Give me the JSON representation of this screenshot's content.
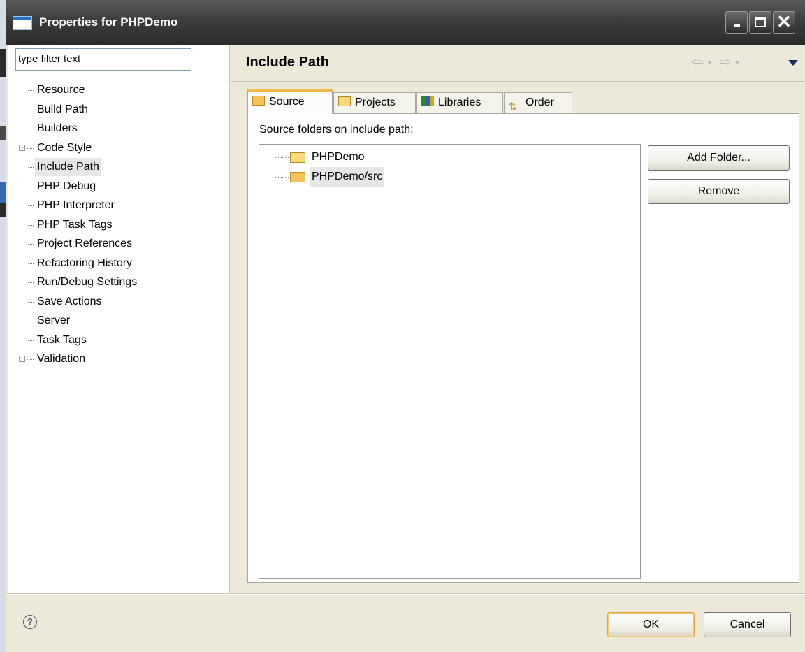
{
  "window": {
    "title": "Properties for PHPDemo"
  },
  "sidebar": {
    "filter_text": "type filter text",
    "items": [
      {
        "label": "Resource",
        "expandable": false,
        "selected": false
      },
      {
        "label": "Build Path",
        "expandable": false,
        "selected": false
      },
      {
        "label": "Builders",
        "expandable": false,
        "selected": false
      },
      {
        "label": "Code Style",
        "expandable": true,
        "selected": false
      },
      {
        "label": "Include Path",
        "expandable": false,
        "selected": true
      },
      {
        "label": "PHP Debug",
        "expandable": false,
        "selected": false
      },
      {
        "label": "PHP Interpreter",
        "expandable": false,
        "selected": false
      },
      {
        "label": "PHP Task Tags",
        "expandable": false,
        "selected": false
      },
      {
        "label": "Project References",
        "expandable": false,
        "selected": false
      },
      {
        "label": "Refactoring History",
        "expandable": false,
        "selected": false
      },
      {
        "label": "Run/Debug Settings",
        "expandable": false,
        "selected": false
      },
      {
        "label": "Save Actions",
        "expandable": false,
        "selected": false
      },
      {
        "label": "Server",
        "expandable": false,
        "selected": false
      },
      {
        "label": "Task Tags",
        "expandable": false,
        "selected": false
      },
      {
        "label": "Validation",
        "expandable": true,
        "selected": false
      }
    ],
    "expander_symbol": "+"
  },
  "main": {
    "title": "Include Path",
    "nav": {
      "back_icon": "arrow-left-icon",
      "forward_icon": "arrow-right-icon",
      "menu_icon": "view-menu-icon"
    },
    "tabs": [
      {
        "label": "Source",
        "icon": "source-folder-icon",
        "active": true
      },
      {
        "label": "Projects",
        "icon": "project-folder-icon",
        "active": false
      },
      {
        "label": "Libraries",
        "icon": "libraries-icon",
        "active": false
      },
      {
        "label": "Order",
        "icon": "order-icon",
        "active": false
      }
    ],
    "panel_label": "Source folders on include path:",
    "source_items": [
      {
        "label": "PHPDemo",
        "icon": "project-folder-icon",
        "selected": false
      },
      {
        "label": "PHPDemo/src",
        "icon": "source-folder-icon",
        "selected": true
      }
    ],
    "add_folder_label": "Add Folder...",
    "remove_label": "Remove"
  },
  "footer": {
    "help_symbol": "?",
    "ok_label": "OK",
    "cancel_label": "Cancel"
  },
  "colors": {
    "title_bar": "#3d3d3d",
    "dialog_bg": "#ece9d8",
    "active_tab_accent": "#f7b84a",
    "default_button_border": "#e7a33b"
  }
}
